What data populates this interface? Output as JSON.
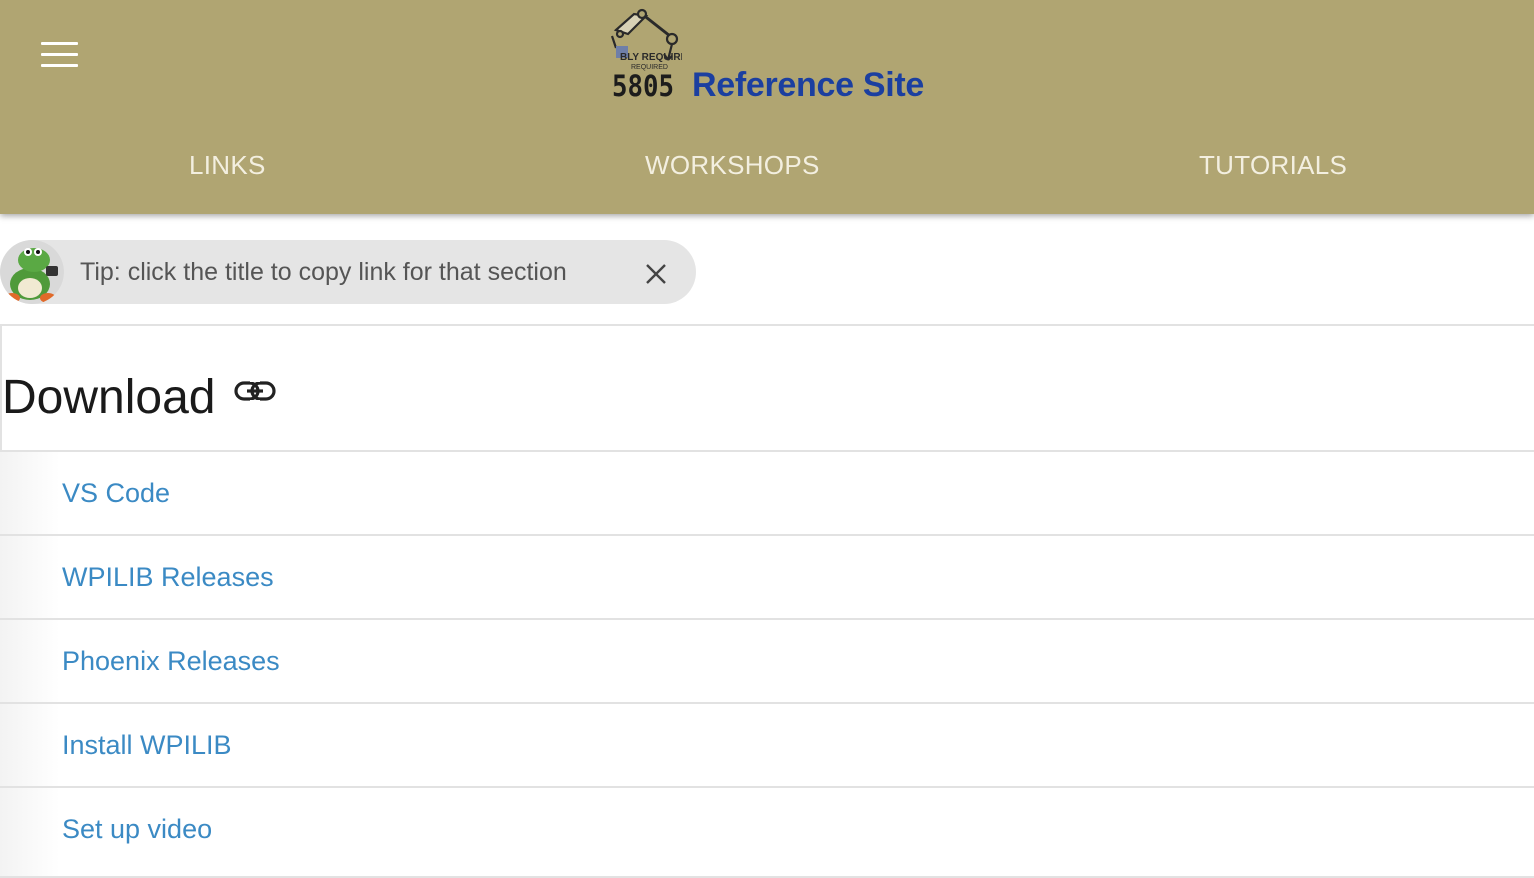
{
  "header": {
    "menu_icon": "hamburger-menu-icon",
    "logo": {
      "icon": "robot-arm-logo",
      "number": "5805",
      "tagline": "BLY REQUIRED",
      "tagline_sub": "REQUIRED"
    },
    "title": "Reference Site",
    "title_color": "#1b3fa0",
    "background": "#b0a572",
    "nav": [
      {
        "label": "LINKS"
      },
      {
        "label": "WORKSHOPS"
      },
      {
        "label": "TUTORIALS"
      }
    ]
  },
  "tip": {
    "avatar_icon": "green-dinosaur-avatar",
    "text": "Tip: click the title to copy link for that section",
    "close_icon": "close-icon"
  },
  "section": {
    "title": "Download",
    "link_icon": "link-icon",
    "items": [
      {
        "label": "VS Code"
      },
      {
        "label": "WPILIB Releases"
      },
      {
        "label": "Phoenix Releases"
      },
      {
        "label": "Install WPILIB"
      },
      {
        "label": "Set up video"
      }
    ],
    "link_color": "#3b8ac4"
  }
}
